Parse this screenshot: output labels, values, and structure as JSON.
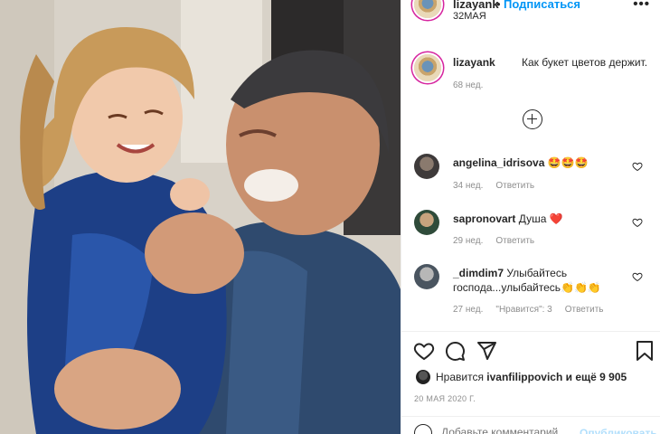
{
  "post": {
    "username": "lizayank",
    "follow_label": "Подписаться",
    "separator": "•",
    "header_date": "32МАЯ",
    "more_icon": "•••"
  },
  "caption": {
    "username": "lizayank",
    "text": "Как букет цветов держит.",
    "time": "68 нед."
  },
  "comments": [
    {
      "username": "angelina_idrisova",
      "text": "🤩🤩🤩",
      "time": "34 нед.",
      "reply_label": "Ответить",
      "likes_label": ""
    },
    {
      "username": "sapronovart",
      "text": "Душа ❤️",
      "time": "29 нед.",
      "reply_label": "Ответить",
      "likes_label": ""
    },
    {
      "username": "_dimdim7",
      "text": "Улыбайтесь господа...улыбайтесь👏👏👏",
      "time": "27 нед.",
      "reply_label": "Ответить",
      "likes_label": "\"Нравится\": 3"
    }
  ],
  "likes": {
    "prefix": "Нравится",
    "user": "ivanfilippovich",
    "suffix": "и ещё 9 905"
  },
  "post_date": "20 МАЯ 2020 Г.",
  "composer": {
    "placeholder": "Добавьте комментарий...",
    "publish_label": "Опубликовать"
  },
  "colors": {
    "accent": "#0095f6",
    "heart_red": "#ed4956",
    "muted": "#8e8e8e"
  }
}
